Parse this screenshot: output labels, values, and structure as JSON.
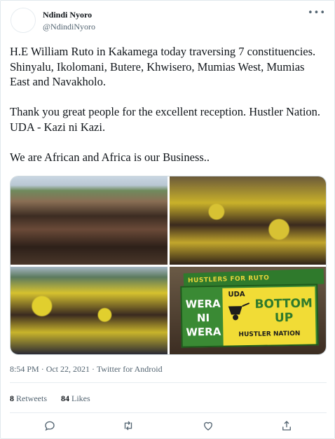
{
  "user": {
    "name": "Ndindi Nyoro",
    "handle": "@NdindiNyoro"
  },
  "more_icon": "more-horizontal-icon",
  "tweet": {
    "paragraph_1": "H.E William Ruto in Kakamega today traversing 7 constituencies. Shinyalu, Ikolomani, Butere, Khwisero, Mumias West, Mumias East and Navakholo.",
    "paragraph_2": "Thank you great people for the excellent reception. Hustler Nation. UDA - Kazi ni Kazi.",
    "paragraph_3": "We are African and Africa is our Business.."
  },
  "media": {
    "photos": [
      {
        "alt": "crowd-photo-1"
      },
      {
        "alt": "crowd-photo-2"
      },
      {
        "alt": "crowd-photo-3"
      },
      {
        "alt": "poster-photo-4"
      }
    ],
    "poster": {
      "banner": "HUSTLERS FOR RUTO",
      "left_text": "WERA NI WERA",
      "uda": "UDA",
      "bottom_up": "BOTTOM UP",
      "hustler_nation": "HUSTLER NATION"
    }
  },
  "meta": {
    "time": "8:54 PM",
    "separator_1": "·",
    "date": "Oct 22, 2021",
    "separator_2": "·",
    "source": "Twitter for Android"
  },
  "stats": {
    "retweets_count": "8",
    "retweets_label": "Retweets",
    "likes_count": "84",
    "likes_label": "Likes"
  },
  "actions": {
    "reply_icon": "reply-icon",
    "retweet_icon": "retweet-icon",
    "like_icon": "heart-icon",
    "share_icon": "share-icon"
  },
  "colors": {
    "text": "#0f1419",
    "secondary": "#536471",
    "border": "#e6ecf0"
  }
}
